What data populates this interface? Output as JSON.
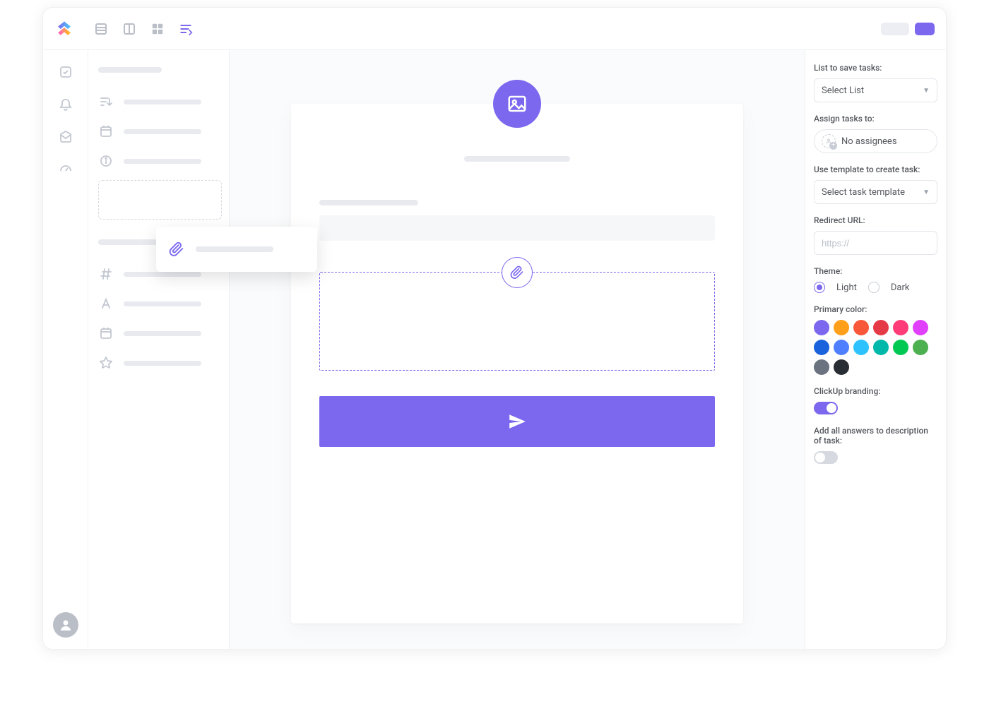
{
  "settings": {
    "list_label": "List to save tasks:",
    "list_value": "Select List",
    "assign_label": "Assign tasks to:",
    "assign_value": "No assignees",
    "template_label": "Use template to create task:",
    "template_value": "Select task template",
    "redirect_label": "Redirect URL:",
    "redirect_placeholder": "https://",
    "theme_label": "Theme:",
    "theme_light": "Light",
    "theme_dark": "Dark",
    "theme_selected": "light",
    "primary_color_label": "Primary color:",
    "colors": [
      "#7b68ee",
      "#ff9f1a",
      "#f8573a",
      "#e63946",
      "#ff3c78",
      "#e040fb",
      "#1b63dc",
      "#4f7fff",
      "#2ec2ff",
      "#00b8a9",
      "#00c853",
      "#ff5722",
      "#6b7280",
      "#292d34"
    ],
    "branding_label": "ClickUp branding:",
    "branding_on": true,
    "answers_label": "Add all answers to description of task:",
    "answers_on": false
  },
  "swatch_rows": [
    [
      "#7b68ee",
      "#ff9f1a",
      "#f8573a",
      "#e63946",
      "#ff3c78",
      "#e040fb"
    ],
    [
      "#1b63dc",
      "#4f7fff",
      "#2ec2ff",
      "#00b8a9",
      "#00c853"
    ],
    [
      "#4caf50",
      "#6b7280",
      "#292d34"
    ]
  ]
}
